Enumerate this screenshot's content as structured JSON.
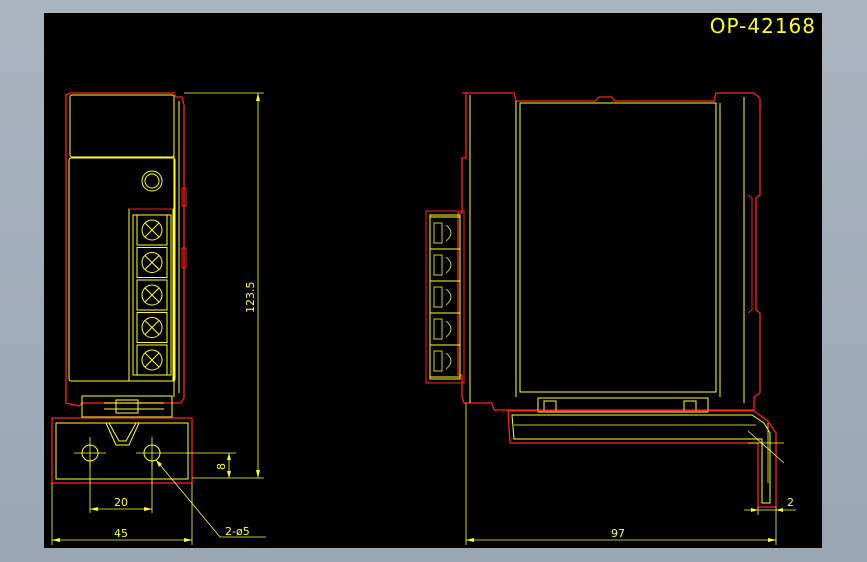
{
  "drawing": {
    "title": "OP-42168",
    "dimensions": {
      "height": "123.5",
      "front_offset": "8",
      "hole_spacing": "20",
      "base_width": "45",
      "holes": "2-ø5",
      "depth": "97",
      "flange": "2"
    }
  },
  "colors": {
    "background": "#000000",
    "frame": "#aab4c1",
    "outline": "#ff2020",
    "geometry": "#ffff33",
    "title": "#ffff33"
  }
}
